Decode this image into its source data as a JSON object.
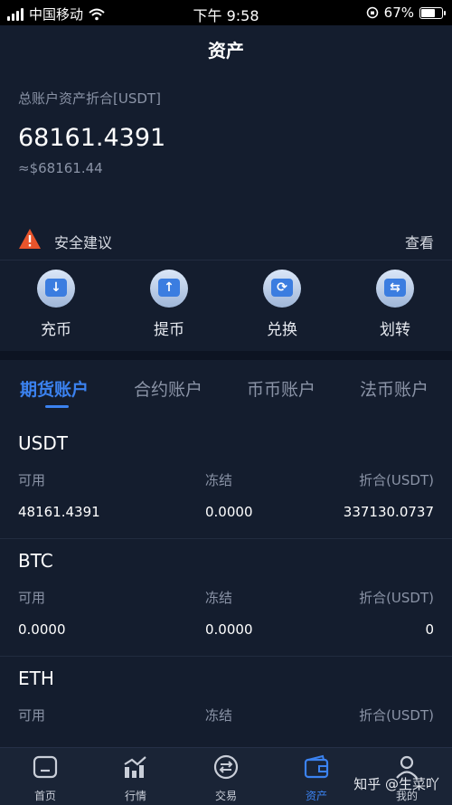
{
  "status_bar": {
    "carrier": "中国移动",
    "time": "下午 9:58",
    "battery": "67%"
  },
  "header": {
    "title": "资产"
  },
  "summary": {
    "label": "总账户资产折合[USDT]",
    "value": "68161.4391",
    "approx": "≈$68161.44"
  },
  "security": {
    "text": "安全建议",
    "link": "查看",
    "icon": "warning-icon",
    "icon_color": "#e8542b"
  },
  "actions": [
    {
      "label": "充币",
      "icon": "deposit-icon",
      "glyph": "↓"
    },
    {
      "label": "提币",
      "icon": "withdraw-icon",
      "glyph": "↑"
    },
    {
      "label": "兑换",
      "icon": "exchange-icon",
      "glyph": "⟳"
    },
    {
      "label": "划转",
      "icon": "transfer-icon",
      "glyph": "⇆"
    }
  ],
  "tabs": [
    {
      "label": "期货账户",
      "active": true
    },
    {
      "label": "合约账户",
      "active": false
    },
    {
      "label": "币币账户",
      "active": false
    },
    {
      "label": "法币账户",
      "active": false
    }
  ],
  "assets": [
    {
      "name": "USDT",
      "available_label": "可用",
      "frozen_label": "冻结",
      "value_label": "折合(USDT)",
      "available": "48161.4391",
      "frozen": "0.0000",
      "value": "337130.0737"
    },
    {
      "name": "BTC",
      "available_label": "可用",
      "frozen_label": "冻结",
      "value_label": "折合(USDT)",
      "available": "0.0000",
      "frozen": "0.0000",
      "value": "0"
    },
    {
      "name": "ETH",
      "available_label": "可用",
      "frozen_label": "冻结",
      "value_label": "折合(USDT)",
      "available": "",
      "frozen": "",
      "value": ""
    }
  ],
  "tabbar": [
    {
      "label": "首页",
      "icon": "home-icon",
      "active": false
    },
    {
      "label": "行情",
      "icon": "chart-icon",
      "active": false
    },
    {
      "label": "交易",
      "icon": "trade-icon",
      "active": false
    },
    {
      "label": "资产",
      "icon": "wallet-icon",
      "active": true
    },
    {
      "label": "我的",
      "icon": "profile-icon",
      "active": false
    }
  ],
  "watermark": "知乎 @生菜吖",
  "colors": {
    "background": "#141d2e",
    "accent": "#3b82f0",
    "muted_text": "#8a93a6"
  }
}
